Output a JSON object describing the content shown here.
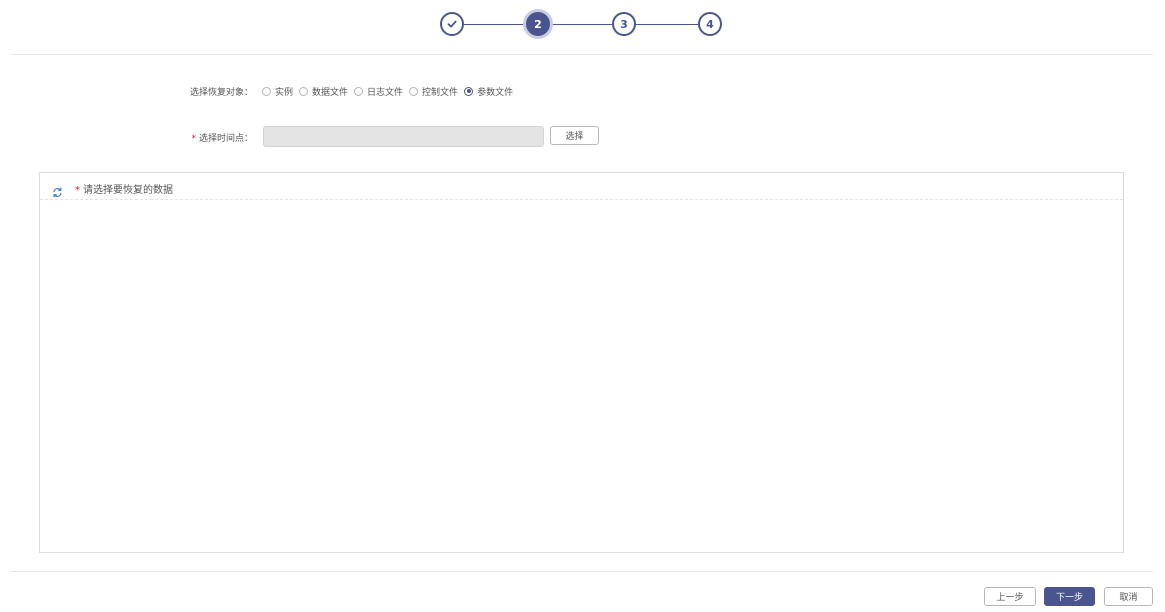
{
  "stepper": {
    "steps": [
      {
        "label": "",
        "state": "done"
      },
      {
        "label": "2",
        "state": "active"
      },
      {
        "label": "3",
        "state": "pending"
      },
      {
        "label": "4",
        "state": "pending"
      }
    ],
    "color": "#4a5590"
  },
  "form": {
    "restore_target_label": "选择恢复对象：",
    "restore_target_options": [
      "实例",
      "数据文件",
      "日志文件",
      "控制文件",
      "参数文件"
    ],
    "restore_target_selected": "参数文件",
    "required_mark": "*",
    "time_point_label": "选择时间点：",
    "time_point_value": "",
    "select_button": "选择"
  },
  "panel": {
    "required_mark": "*",
    "title": "请选择要恢复的数据"
  },
  "footer": {
    "prev_button": "上一步",
    "next_button": "下一步",
    "cancel_button": "取消"
  },
  "colors": {
    "primary": "#4a5590",
    "required": "#e02020",
    "refresh_icon": "#3a7bd5"
  }
}
